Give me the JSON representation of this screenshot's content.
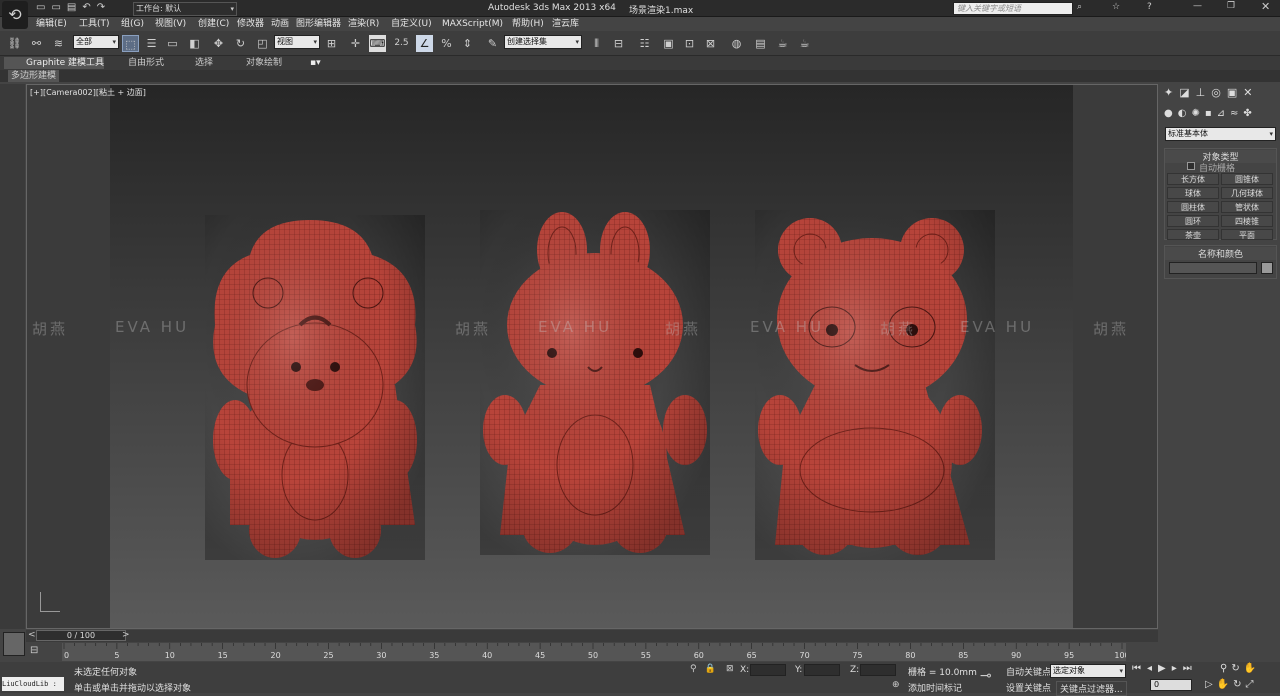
{
  "titlebar": {
    "workspace_label": "工作台: 默认",
    "app_title": "Autodesk 3ds Max  2013 x64",
    "file_name": "场景渲染1.max",
    "search_placeholder": "键入关键字或短语"
  },
  "menu": [
    "编辑(E)",
    "工具(T)",
    "组(G)",
    "视图(V)",
    "创建(C)",
    "修改器",
    "动画",
    "图形编辑器",
    "渲染(R)",
    "自定义(U)",
    "MAXScript(M)",
    "帮助(H)",
    "渲云库"
  ],
  "toolbar": {
    "selection_filter": "全部",
    "ref_coord": "视图",
    "snap_label": "2.5",
    "named_selection": "创建选择集"
  },
  "ribbon": {
    "tabs": [
      "Graphite 建模工具",
      "自由形式",
      "选择",
      "对象绘制"
    ],
    "sub_tab": "多边形建模"
  },
  "viewport": {
    "label": "[+][Camera002][粘土 + 边面]",
    "watermark_cn": "胡燕",
    "watermark_en": "EVA HU"
  },
  "command_panel": {
    "category": "标准基本体",
    "rollout_object_type": "对象类型",
    "autogrid": "自动栅格",
    "primitives": [
      "长方体",
      "圆锥体",
      "球体",
      "几何球体",
      "圆柱体",
      "管状体",
      "圆环",
      "四棱锥",
      "茶壶",
      "平面"
    ],
    "rollout_name_color": "名称和颜色"
  },
  "timeline": {
    "frame_label": "0 / 100",
    "ticks": [
      "0",
      "5",
      "10",
      "15",
      "20",
      "25",
      "30",
      "35",
      "40",
      "45",
      "50",
      "55",
      "60",
      "65",
      "70",
      "75",
      "80",
      "85",
      "90",
      "95",
      "100"
    ]
  },
  "status": {
    "script_listener": "LiuCloudLib :",
    "msg1": "未选定任何对象",
    "msg2": "单击或单击并拖动以选择对象",
    "x_label": "X:",
    "y_label": "Y:",
    "z_label": "Z:",
    "grid": "栅格 = 10.0mm",
    "add_time_tag": "添加时间标记",
    "auto_key": "自动关键点",
    "set_key": "设置关键点",
    "key_mode": "选定对象",
    "key_filters": "关键点过滤器...",
    "frame_value": "0"
  },
  "colors": {
    "model_red": "#b8443a",
    "bg": "#444444"
  }
}
